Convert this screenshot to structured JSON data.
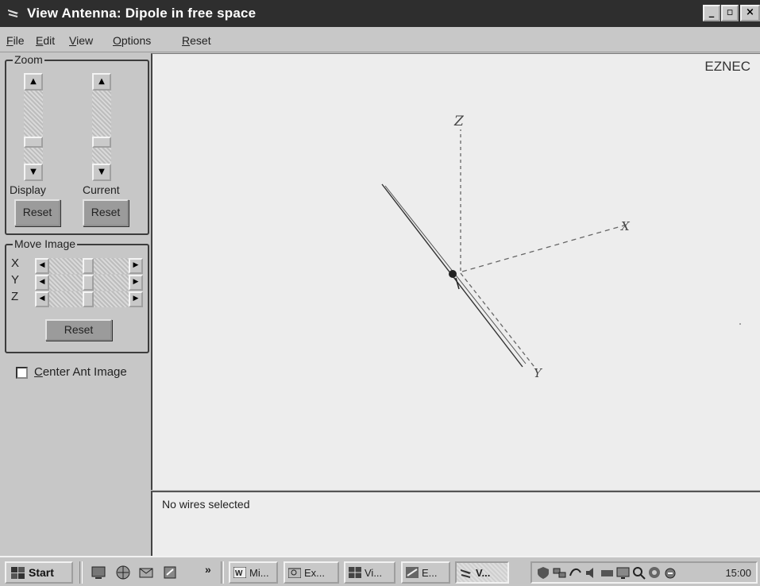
{
  "window": {
    "title": "View Antenna: Dipole in free space",
    "controls": {
      "minimize": "_",
      "maximize": "▫",
      "close": "×"
    }
  },
  "menu": [
    "File",
    "Edit",
    "View",
    "Options",
    "Reset"
  ],
  "zoom": {
    "legend": "Zoom",
    "display_label": "Display",
    "current_label": "Current",
    "reset_label": "Reset"
  },
  "move_image": {
    "legend": "Move Image",
    "axes": [
      "X",
      "Y",
      "Z"
    ],
    "reset_label": "Reset"
  },
  "center_ant_image": {
    "label": "Center Ant Image",
    "checked": false
  },
  "canvas": {
    "brand": "EZNEC",
    "axis_labels": {
      "z": "Z",
      "x": "X",
      "y": "Y"
    }
  },
  "status": {
    "text": "No wires selected"
  },
  "taskbar": {
    "start_label": "Start",
    "more": "»",
    "tasks": [
      "Mi...",
      "Ex...",
      "Vi...",
      "E...",
      "V..."
    ],
    "active_task": "V...",
    "clock": "15:00"
  }
}
